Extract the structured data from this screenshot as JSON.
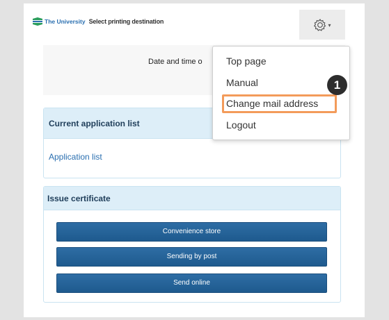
{
  "header": {
    "logo_text": "The University",
    "destination_label": "Select printing destination",
    "settings_caret": "▾"
  },
  "info": {
    "date_text": "Date and time o"
  },
  "current_panel": {
    "title": "Current application list",
    "link": "Application list"
  },
  "issue_panel": {
    "title": "Issue certificate",
    "buttons": [
      "Convenience store",
      "Sending by post",
      "Send online"
    ]
  },
  "dropdown": {
    "items": [
      "Top page",
      "Manual",
      "Change mail address",
      "Logout"
    ]
  },
  "annotation": {
    "step_number": "1"
  },
  "colors": {
    "accent": "#2a6fb0",
    "button": "#1e5a8e",
    "panel_header": "#ddeef8",
    "highlight": "#f39b5a"
  }
}
